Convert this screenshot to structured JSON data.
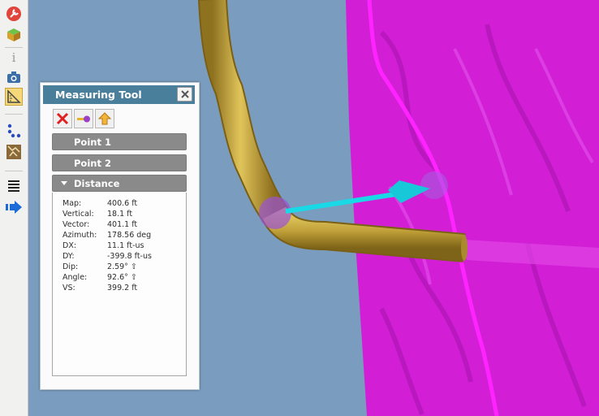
{
  "panel": {
    "title": "Measuring Tool",
    "sections": {
      "point1": "Point 1",
      "point2": "Point 2",
      "distance": "Distance"
    },
    "rows": [
      {
        "label": "Map:",
        "value": "400.6 ft"
      },
      {
        "label": "Vertical:",
        "value": "18.1 ft"
      },
      {
        "label": "Vector:",
        "value": "401.1 ft"
      },
      {
        "label": "Azimuth:",
        "value": "178.56 deg"
      },
      {
        "label": "DX:",
        "value": "11.1 ft-us"
      },
      {
        "label": "DY:",
        "value": "-399.8 ft-us"
      },
      {
        "label": "Dip:",
        "value": "2.59° ⇧"
      },
      {
        "label": "Angle:",
        "value": "92.6° ⇧"
      },
      {
        "label": "VS:",
        "value": "399.2 ft"
      }
    ]
  },
  "toolbar": {
    "info_glyph": "i"
  },
  "colors": {
    "sky": "#7a9dbf",
    "horizon": "#d020d8",
    "wellbore": "#c4a53c",
    "vector": "#19d9e6",
    "panel_header": "#4a7f9b"
  }
}
